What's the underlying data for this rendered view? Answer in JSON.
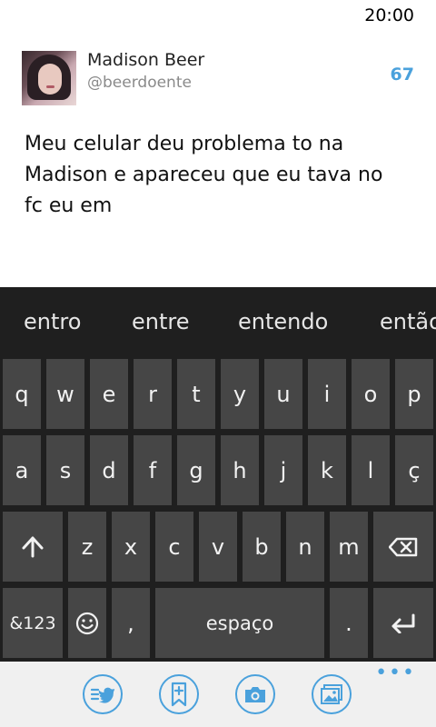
{
  "status_bar": {
    "time": "20:00"
  },
  "composer": {
    "user_name": "Madison Beer",
    "user_handle": "@beerdoente",
    "char_count": "67",
    "text": "Meu celular deu problema to na Madison e apareceu que eu tava no fc eu em"
  },
  "keyboard": {
    "suggestions": [
      "entro",
      "entre",
      "entendo",
      "então"
    ],
    "row1": [
      "q",
      "w",
      "e",
      "r",
      "t",
      "y",
      "u",
      "i",
      "o",
      "p"
    ],
    "row2": [
      "a",
      "s",
      "d",
      "f",
      "g",
      "h",
      "j",
      "k",
      "l",
      "ç"
    ],
    "row3": [
      "z",
      "x",
      "c",
      "v",
      "b",
      "n",
      "m"
    ],
    "symbols_label": "&123",
    "comma_label": ",",
    "space_label": "espaço",
    "period_label": ".",
    "icons": {
      "shift": "shift-arrow-icon",
      "backspace": "backspace-icon",
      "emoji": "emoji-icon",
      "enter": "enter-icon"
    }
  },
  "app_bar": {
    "buttons": [
      "tweet-list-icon",
      "new-tweet-icon",
      "camera-icon",
      "gallery-icon"
    ],
    "more_label": "•••",
    "accent_color": "#4aa1dc"
  }
}
